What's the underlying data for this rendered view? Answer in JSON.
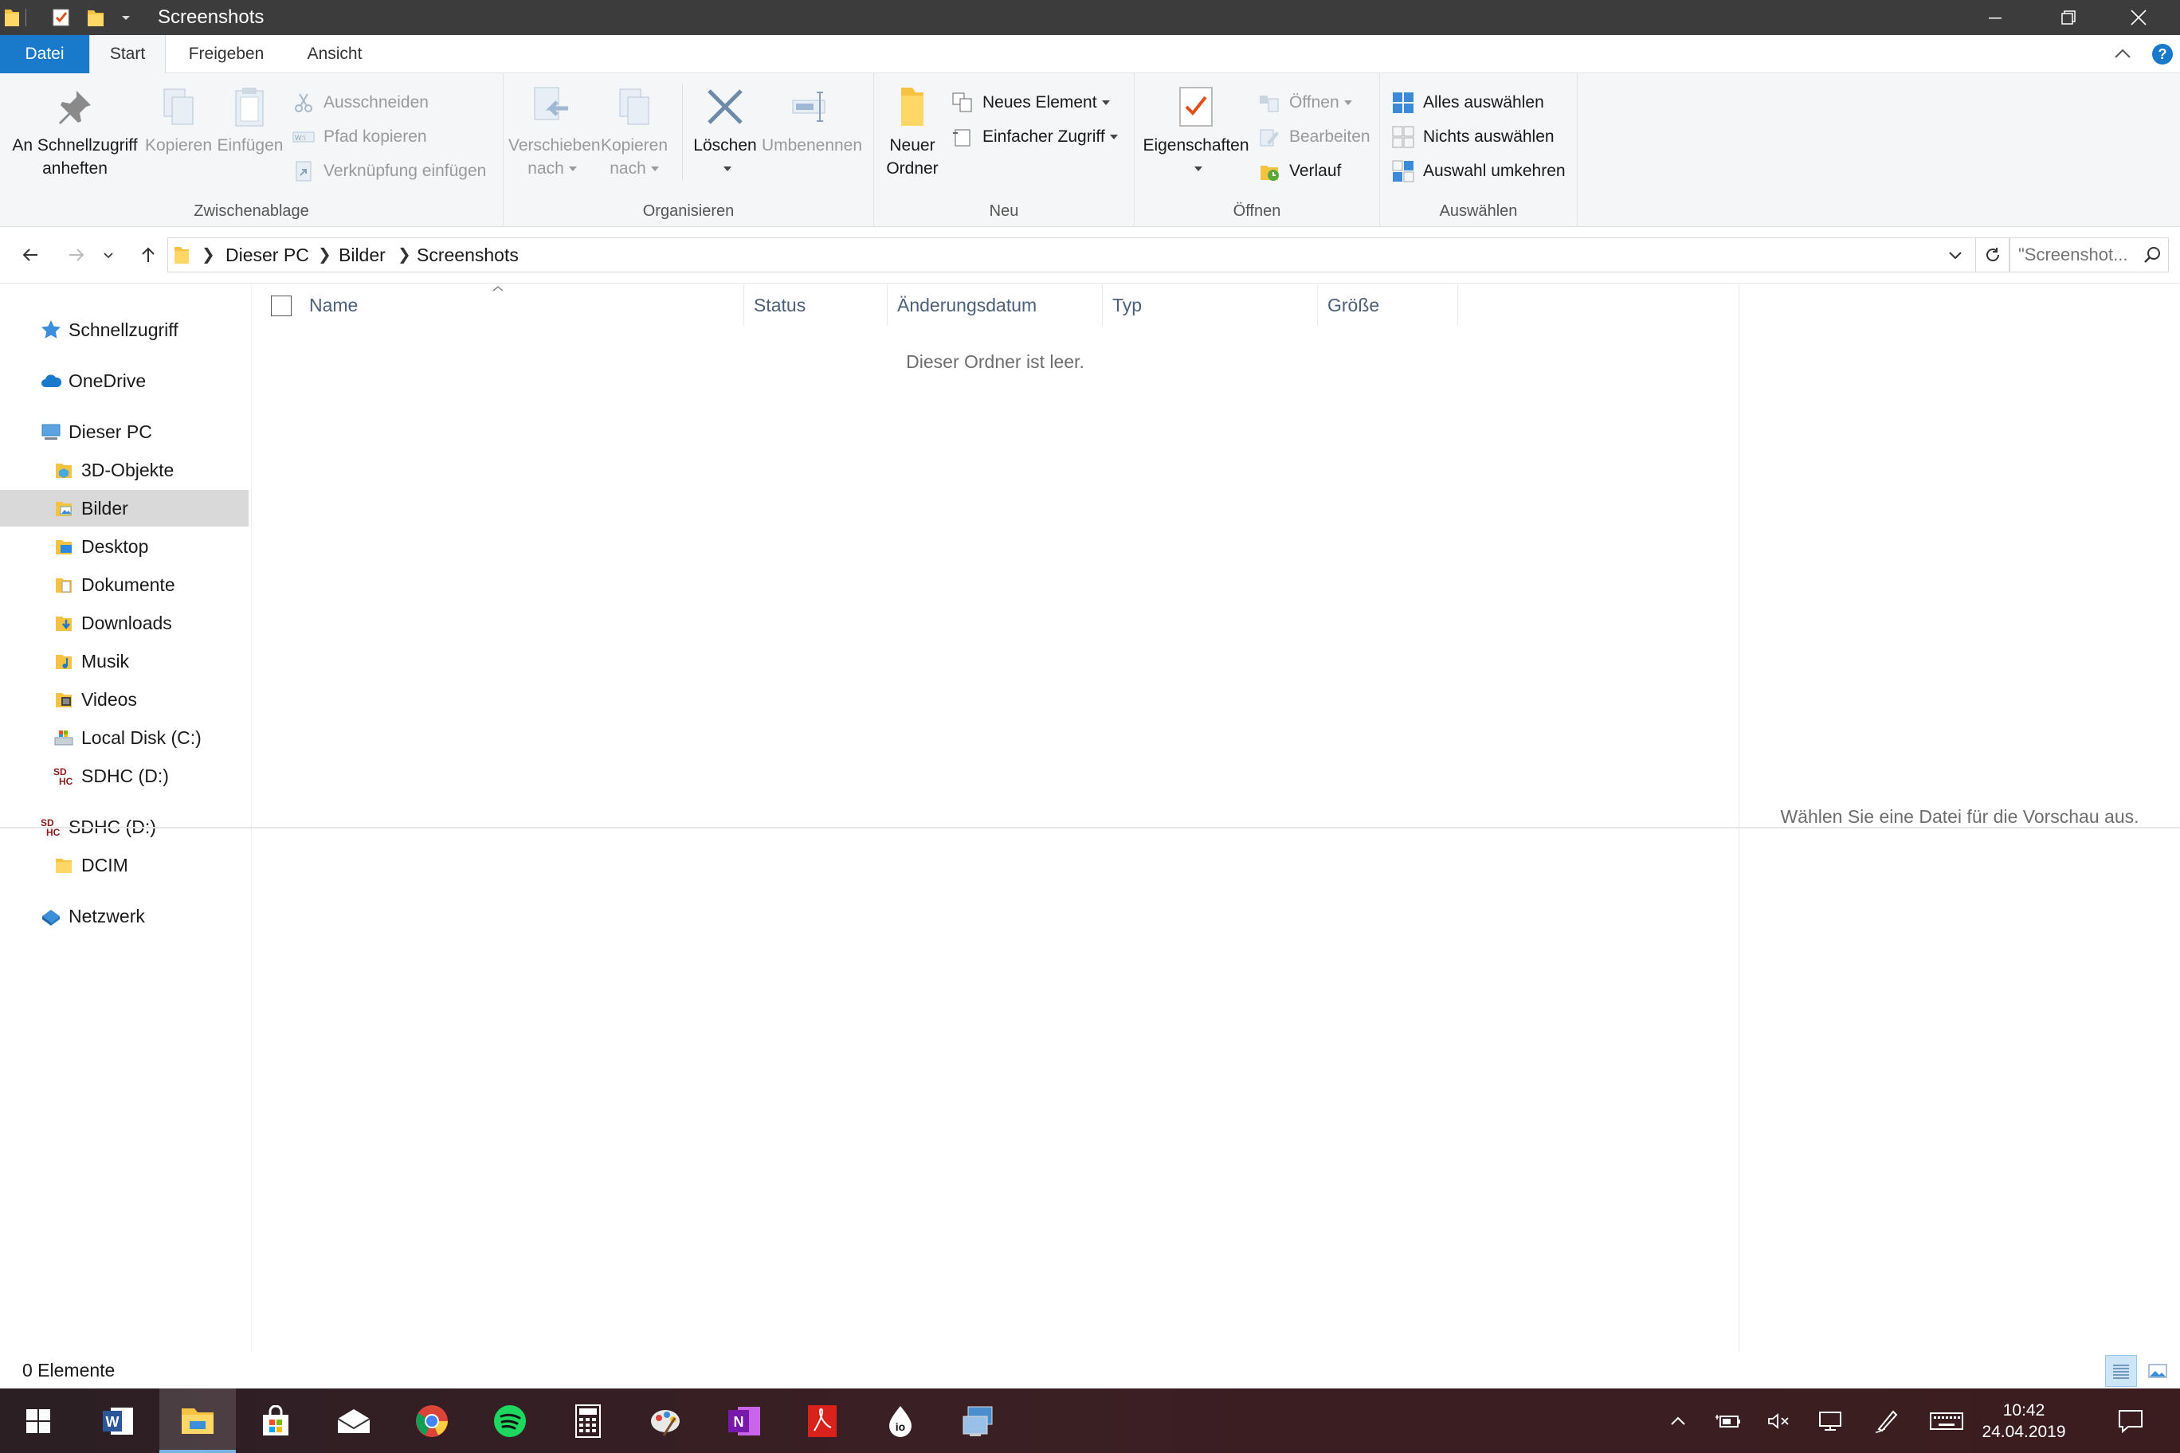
{
  "window": {
    "title": "Screenshots"
  },
  "ribbon_tabs": [
    "Datei",
    "Start",
    "Freigeben",
    "Ansicht"
  ],
  "clipboard": {
    "pin_label_1": "An Schnellzugriff",
    "pin_label_2": "anheften",
    "copy_label": "Kopieren",
    "paste_label": "Einfügen",
    "cut_label": "Ausschneiden",
    "copy_path_label": "Pfad kopieren",
    "paste_shortcut_label": "Verknüpfung einfügen",
    "group_label": "Zwischenablage"
  },
  "organize": {
    "move_label_1": "Verschieben",
    "move_label_2": "nach",
    "copyto_label_1": "Kopieren",
    "copyto_label_2": "nach",
    "delete_label": "Löschen",
    "rename_label": "Umbenennen",
    "group_label": "Organisieren"
  },
  "new": {
    "new_folder_label_1": "Neuer",
    "new_folder_label_2": "Ordner",
    "new_item_label": "Neues Element",
    "easy_access_label": "Einfacher Zugriff",
    "group_label": "Neu"
  },
  "open": {
    "properties_label": "Eigenschaften",
    "open_label": "Öffnen",
    "edit_label": "Bearbeiten",
    "history_label": "Verlauf",
    "group_label": "Öffnen"
  },
  "select": {
    "select_all_label": "Alles auswählen",
    "select_none_label": "Nichts auswählen",
    "invert_label": "Auswahl umkehren",
    "group_label": "Auswählen"
  },
  "address": {
    "breadcrumbs": [
      "Dieser PC",
      "Bilder",
      "Screenshots"
    ],
    "search_placeholder": "\"Screenshot..."
  },
  "nav_pane": [
    {
      "label": "Schnellzugriff",
      "icon": "star-icon"
    },
    {
      "label": "OneDrive",
      "icon": "cloud-icon"
    },
    {
      "label": "Dieser PC",
      "icon": "computer-icon"
    },
    {
      "label": "3D-Objekte",
      "icon": "folder-3d-icon"
    },
    {
      "label": "Bilder",
      "icon": "folder-pictures-icon"
    },
    {
      "label": "Desktop",
      "icon": "folder-desktop-icon"
    },
    {
      "label": "Dokumente",
      "icon": "folder-documents-icon"
    },
    {
      "label": "Downloads",
      "icon": "folder-downloads-icon"
    },
    {
      "label": "Musik",
      "icon": "folder-music-icon"
    },
    {
      "label": "Videos",
      "icon": "folder-videos-icon"
    },
    {
      "label": "Local Disk (C:)",
      "icon": "disk-icon"
    },
    {
      "label": "SDHC (D:)",
      "icon": "sd-card-icon"
    },
    {
      "label": "SDHC (D:)",
      "icon": "sd-card-icon"
    },
    {
      "label": "DCIM",
      "icon": "folder-icon"
    },
    {
      "label": "Netzwerk",
      "icon": "network-icon"
    }
  ],
  "columns": [
    "Name",
    "Status",
    "Änderungsdatum",
    "Typ",
    "Größe"
  ],
  "empty_message": "Dieser Ordner ist leer.",
  "preview_message": "Wählen Sie eine Datei für die Vorschau aus.",
  "status": {
    "item_count": "0 Elemente"
  },
  "taskbar": {
    "clock_time": "10:42",
    "clock_date": "24.04.2019",
    "apps": [
      "word-icon",
      "file-explorer-icon",
      "store-icon",
      "mail-icon",
      "chrome-icon",
      "spotify-icon",
      "calculator-icon",
      "paint-icon",
      "onenote-icon",
      "acrobat-icon",
      "ink-icon",
      "remote-desktop-icon"
    ]
  },
  "colors": {
    "accent": "#1979ca",
    "ribbon_bg": "#f5f6f7",
    "titlebar_bg": "#3c3c3c",
    "selection_bg": "#d9d9d9"
  }
}
